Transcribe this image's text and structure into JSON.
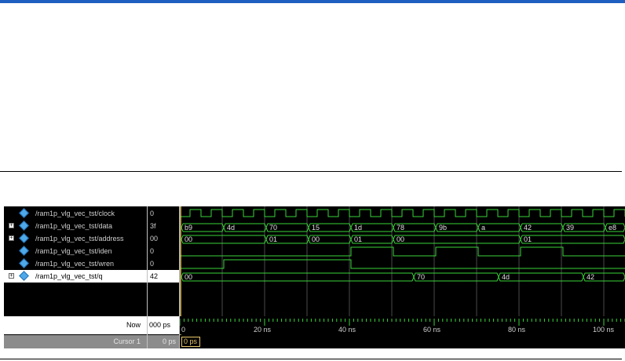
{
  "signals": [
    {
      "name": "/ram1p_vlg_vec_tst/clock",
      "value": "0",
      "expandable": false
    },
    {
      "name": "/ram1p_vlg_vec_tst/data",
      "value": "3f",
      "expandable": true
    },
    {
      "name": "/ram1p_vlg_vec_tst/address",
      "value": "00",
      "expandable": true
    },
    {
      "name": "/ram1p_vlg_vec_tst/iden",
      "value": "0",
      "expandable": false
    },
    {
      "name": "/ram1p_vlg_vec_tst/wren",
      "value": "0",
      "expandable": false
    },
    {
      "name": "/ram1p_vlg_vec_tst/q",
      "value": "42",
      "expandable": true
    }
  ],
  "now": {
    "label": "Now",
    "value": "000 ps"
  },
  "cursor": {
    "label": "Cursor 1",
    "value": "0 ps",
    "marker": "0 ps"
  },
  "timeline": {
    "labels": [
      "0",
      "20 ns",
      "40 ns",
      "60 ns",
      "80 ns",
      "100 ns"
    ]
  },
  "waves": {
    "data": [
      "b9",
      "4d",
      "70",
      "15",
      "1d",
      "78",
      "9b",
      "a",
      "42",
      "39",
      "e8"
    ],
    "address": [
      "00",
      "01",
      "00",
      "01",
      "00",
      "01"
    ],
    "q": [
      "00",
      "70",
      "4d",
      "42"
    ]
  },
  "colors": {
    "wave": "#39d439",
    "grid": "#4a4a4a"
  }
}
